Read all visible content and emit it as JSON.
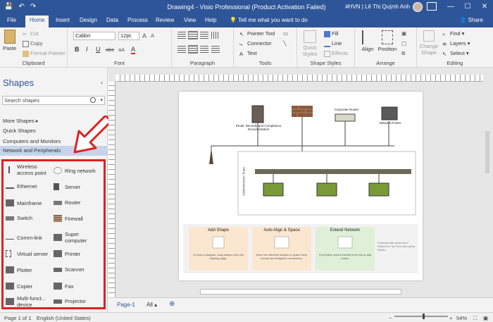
{
  "titlebar": {
    "title": "Drawing4 - Visio Professional (Product Activation Failed)",
    "user": "#HVN | Lê Thị Quỳnh Anh",
    "minimize": "—",
    "maximize": "☐",
    "close": "✕",
    "save_glyph": "💾",
    "undo_glyph": "↶",
    "redo_glyph": "↷"
  },
  "tabs": [
    "File",
    "Home",
    "Insert",
    "Design",
    "Data",
    "Process",
    "Review",
    "View",
    "Help"
  ],
  "tellme": "Tell me what you want to do",
  "share": "Share",
  "ribbon": {
    "clipboard": {
      "paste": "Paste",
      "cut": "Cut",
      "copy": "Copy",
      "format_painter": "Format Painter",
      "label": "Clipboard"
    },
    "font": {
      "font_name": "Calibri",
      "font_size": "12pt.",
      "label": "Font",
      "bold": "B",
      "italic": "I",
      "underline": "U",
      "strike": "abc",
      "aa_small": "aA",
      "color_a": "A"
    },
    "paragraph": {
      "label": "Paragraph"
    },
    "tools": {
      "pointer": "Pointer Tool",
      "connector": "Connector",
      "text": "Text",
      "label": "Tools"
    },
    "shape_styles": {
      "quick_styles": "Quick Styles",
      "fill": "Fill",
      "line": "Line",
      "effects": "Effects",
      "label": "Shape Styles"
    },
    "arrange": {
      "align": "Align",
      "position": "Position",
      "label": "Arrange"
    },
    "editing": {
      "change_shape": "Change Shape",
      "find": "Find",
      "layers": "Layers",
      "select": "Select",
      "label": "Editing"
    }
  },
  "shapes_pane": {
    "title": "Shapes",
    "search_placeholder": "Search shapes",
    "more_shapes": "More Shapes",
    "stencils": [
      "Quick Shapes",
      "Computers and Monitors",
      "Network and Peripherals"
    ],
    "items": [
      "Wireless access point",
      "Ring network",
      "Ethernet",
      "Server",
      "Mainframe",
      "Router",
      "Switch",
      "Firewall",
      "Comm-link",
      "Super computer",
      "Virtual server",
      "Printer",
      "Plotter",
      "Scanner",
      "Copier",
      "Fax",
      "Multi-funct... device",
      "Projector"
    ]
  },
  "diagram": {
    "email_label": "Email, Records and Compliance Documentation",
    "router_label": "Corporate Router",
    "printer_label": "Network Printer",
    "team_label": "Administration Team",
    "tips": [
      {
        "title": "Add Shape",
        "text": "To build a diagram, drag shapes onto the drawing page."
      },
      {
        "title": "Auto Align & Space",
        "text": "Move the selected shapes to space them evenly and straighten connectors."
      },
      {
        "title": "Extend Network",
        "text": "Pull yellow control handle from hub to add nodes."
      }
    ],
    "side_note": "Finished with these tips? Select the Tip Pane and press Delete."
  },
  "page_tabs": {
    "page": "Page-1",
    "all": "All",
    "add": "⊕"
  },
  "status": {
    "page": "Page 1 of 1",
    "language": "English (United States)",
    "zoom": "54%",
    "zoom_minus": "−",
    "zoom_plus": "+"
  }
}
